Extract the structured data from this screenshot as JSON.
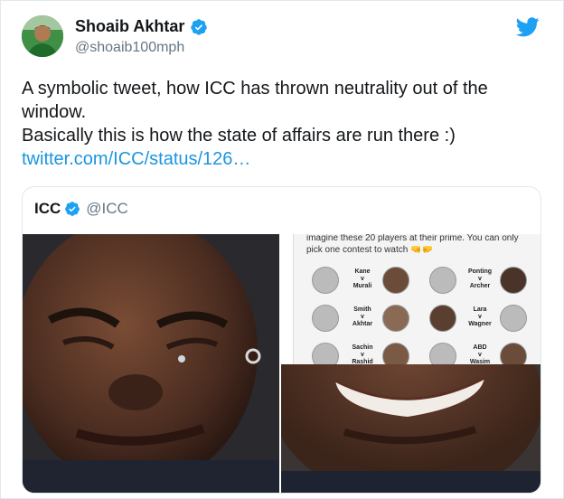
{
  "author": {
    "display_name": "Shoaib Akhtar",
    "handle": "@shoaib100mph",
    "avatar_icon": "profile-photo",
    "verified_icon": "verified-badge-icon"
  },
  "brand": {
    "logo_icon": "twitter-bird-icon",
    "accent": "#1da1f2"
  },
  "tweet": {
    "line1": "A symbolic tweet, how ICC has thrown neutrality out of the",
    "line2": "window.",
    "line3": "Basically this is how the state of affairs are run there  :)",
    "link": "twitter.com/ICC/status/126…"
  },
  "quoted": {
    "display_name": "ICC",
    "handle": "@ICC",
    "graphic": {
      "intro": "imagine these 20 players at their prime. You can only pick one contest to watch 🤜🤛",
      "matchups": [
        [
          "Kane",
          "v",
          "Murali"
        ],
        [
          "Ponting",
          "v",
          "Archer"
        ],
        [
          "Smith",
          "v",
          "Akhtar"
        ],
        [
          "Lara",
          "v",
          "Wagner"
        ],
        [
          "Sachin",
          "v",
          "Rashid"
        ],
        [
          "ABD",
          "v",
          "Wasim"
        ]
      ]
    }
  },
  "colors": {
    "text": "#14171a",
    "secondary": "#657786",
    "link": "#1b95e0",
    "border": "#e1e8ed"
  }
}
